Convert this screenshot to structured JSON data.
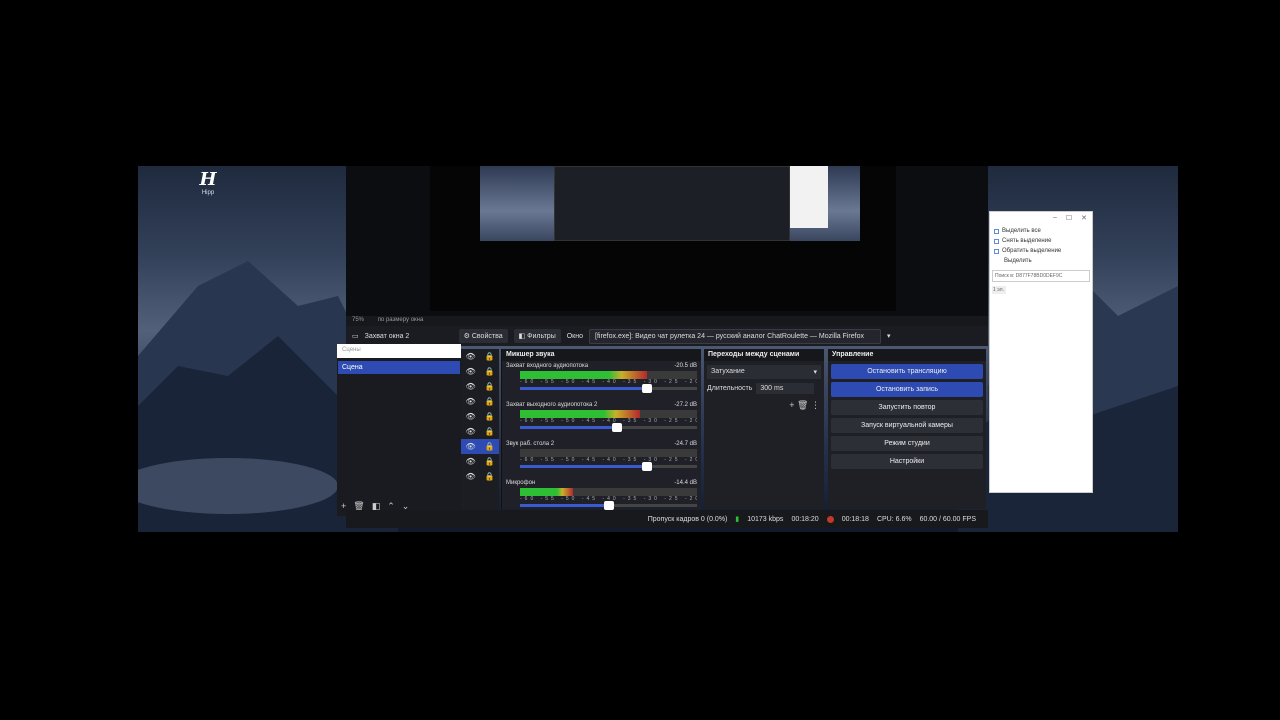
{
  "desktop": {
    "icon_label": "Hipp"
  },
  "obs": {
    "zoom_label": "по размеру окна",
    "zoom_value": "75%",
    "source_name": "Захват окна 2",
    "properties_label": "Свойства",
    "filters_label": "Фильтры",
    "window_label": "Окно",
    "window_value": "[firefox.exe]: Видео чат рулетка 24 — русский аналог ChatRoulette — Mozilla Firefox",
    "scenes": {
      "search_placeholder": "Сцены",
      "items": [
        {
          "label": "Сцена"
        }
      ]
    },
    "mixer": {
      "title": "Микшер звука",
      "ticks": "-60 -55 -50 -45 -40 -35 -30 -25 -20 -15 -10 -5 0",
      "channels": [
        {
          "name": "Захват входного аудиопотока",
          "db": "-20.5 dB",
          "level": 0.72,
          "fader": 0.72
        },
        {
          "name": "Захват выходного аудиопотока 2",
          "db": "-27.2 dB",
          "level": 0.68,
          "fader": 0.55
        },
        {
          "name": "Звук раб. стола 2",
          "db": "-24.7 dB",
          "level": 0.0,
          "fader": 0.72
        },
        {
          "name": "Микрофон",
          "db": "-14.4 dB",
          "level": 0.3,
          "fader": 0.5
        }
      ]
    },
    "transitions": {
      "title": "Переходы между сценами",
      "selected": "Затухание",
      "duration_label": "Длительность",
      "duration_value": "300 ms"
    },
    "controls": {
      "title": "Управление",
      "stop_stream": "Остановить трансляцию",
      "stop_record": "Остановить запись",
      "replay": "Запустить повтор",
      "virtual_cam": "Запуск виртуальной камеры",
      "studio_mode": "Режим студии",
      "settings": "Настройки"
    },
    "status": {
      "dropped": "Пропуск кадров 0 (0.0%)",
      "bitrate": "10173 kbps",
      "stream_time": "00:18:20",
      "rec_time": "00:18:18",
      "cpu": "CPU: 6.6%",
      "fps": "60.00 / 60.00 FPS"
    }
  },
  "explorer": {
    "items": [
      "Выделить все",
      "Снять выделение",
      "Обратить выделение"
    ],
    "group_label": "Выделить",
    "search_placeholder": "Поиск в: D877F78BD0DEF9C",
    "count_label": "1 эл."
  },
  "colors": {
    "accent": "#2d4bb2",
    "meter_green": "#2fbf34",
    "record_red": "#c0392b"
  }
}
